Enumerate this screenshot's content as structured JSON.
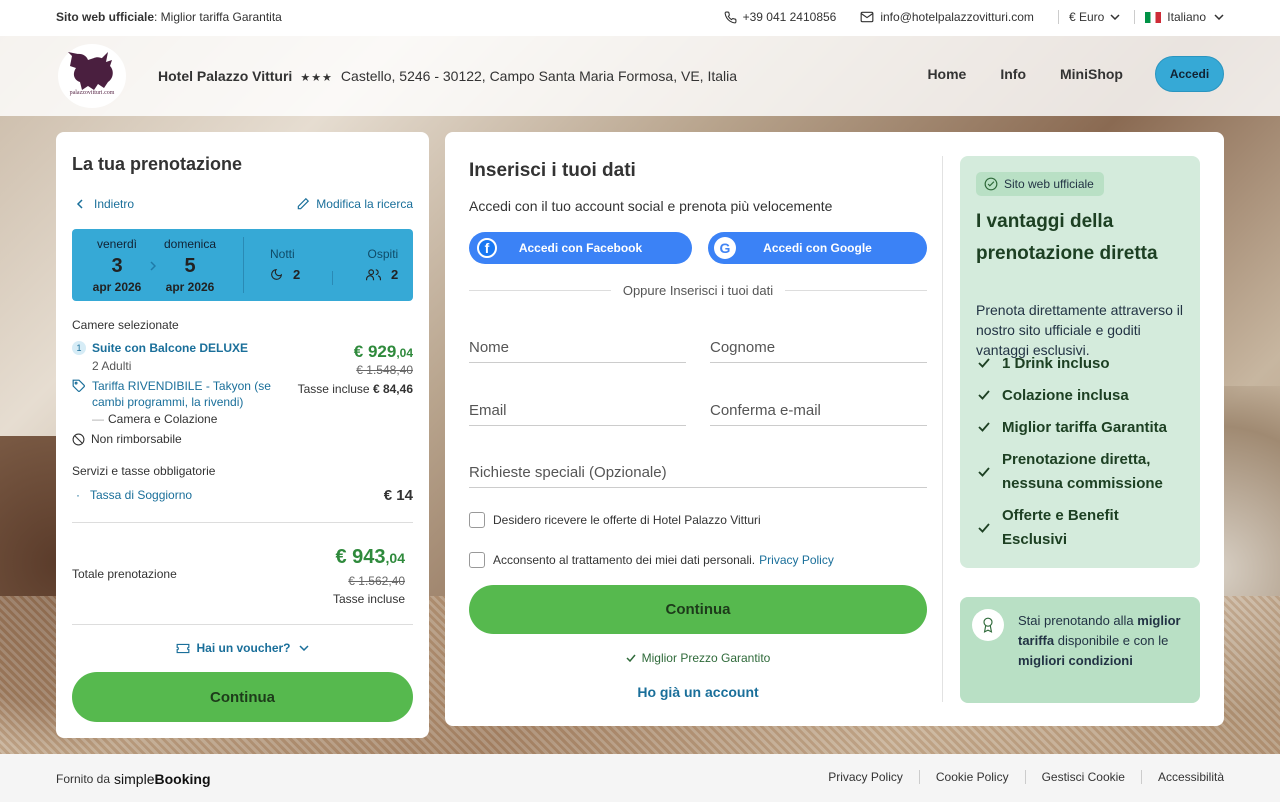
{
  "topbar": {
    "official_bold": "Sito web ufficiale",
    "official_rest": ": Miglior tariffa Garantita",
    "phone": "+39 041 2410856",
    "email": "info@hotelpalazzovitturi.com",
    "currency": "€ Euro",
    "language": "Italiano"
  },
  "header": {
    "logo_text": "palazzovitturi.com",
    "hotel_name": "Hotel Palazzo Vitturi",
    "stars": "★★★",
    "address": "Castello, 5246 - 30122, Campo Santa Maria Formosa, VE, Italia",
    "nav": [
      "Home",
      "Info",
      "MiniShop"
    ],
    "login": "Accedi"
  },
  "booking": {
    "title": "La tua prenotazione",
    "back": "Indietro",
    "edit": "Modifica la ricerca",
    "checkin": {
      "day": "venerdì",
      "num": "3",
      "month": "apr 2026"
    },
    "checkout": {
      "day": "domenica",
      "num": "5",
      "month": "apr 2026"
    },
    "nights_label": "Notti",
    "nights": "2",
    "guests_label": "Ospiti",
    "guests": "2",
    "rooms_title": "Camere selezionate",
    "room_index": "1",
    "room_name": "Suite con Balcone DELUXE",
    "room_guests": "2 Adulti",
    "rate_name": "Tariffa RIVENDIBILE - Takyon (se cambi programmi, la rivendi)",
    "meal": "Camera e Colazione",
    "refund": "Non rimborsabile",
    "price_main": "€ 929",
    "price_dec": ",04",
    "price_old": "€ 1.548,40",
    "taxes_label": "Tasse incluse",
    "taxes_value": "€ 84,46",
    "services_title": "Servizi e tasse obbligatorie",
    "tax_item": "Tassa di Soggiorno",
    "tax_value": "€ 14",
    "total_label": "Totale prenotazione",
    "total_main": "€ 943",
    "total_dec": ",04",
    "total_old": "€ 1.562,40",
    "total_taxes": "Tasse incluse",
    "voucher": "Hai un voucher?",
    "continue": "Continua"
  },
  "form": {
    "title": "Inserisci i tuoi dati",
    "subtitle": "Accedi con il tuo account social e prenota più velocemente",
    "facebook": "Accedi con Facebook",
    "google": "Accedi con Google",
    "or": "Oppure Inserisci i tuoi dati",
    "name": "Nome",
    "surname": "Cognome",
    "email": "Email",
    "email_confirm": "Conferma e-mail",
    "requests": "Richieste speciali (Opzionale)",
    "offers": "Desidero ricevere le offerte di Hotel Palazzo Vitturi",
    "consent": "Acconsento al trattamento dei miei dati personali.",
    "privacy": "Privacy Policy",
    "continue": "Continua",
    "best_price": "Miglior Prezzo Garantito",
    "have_account": "Ho già un account"
  },
  "advantages": {
    "badge": "Sito web ufficiale",
    "title": "I vantaggi della prenotazione diretta",
    "desc": "Prenota direttamente attraverso il nostro sito ufficiale e goditi vantaggi esclusivi.",
    "items": [
      "1 Drink incluso",
      "Colazione inclusa",
      "Miglior tariffa Garantita",
      "Prenotazione diretta, nessuna commissione",
      "Offerte e Benefit Esclusivi"
    ],
    "best_1": "Stai prenotando alla ",
    "best_2": "miglior tariffa",
    "best_3": " disponibile e con le ",
    "best_4": "migliori condizioni"
  },
  "footer": {
    "powered": "Fornito da",
    "brand_light": "simple",
    "brand_bold": "Booking",
    "links": [
      "Privacy Policy",
      "Cookie Policy",
      "Gestisci Cookie",
      "Accessibilità"
    ]
  },
  "colors": {
    "accent_blue": "#36a9d6",
    "green": "#56b94e",
    "advantage_bg": "#d4ebdc"
  }
}
